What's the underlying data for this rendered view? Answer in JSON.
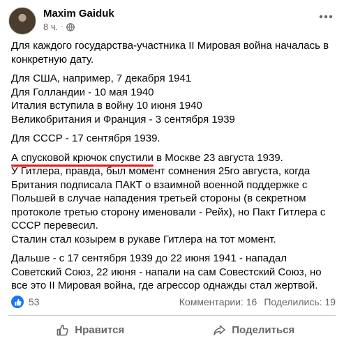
{
  "post": {
    "author": "Maxim Gaiduk",
    "time": "8 ч.",
    "separator": "·",
    "paragraph1": "Для каждого государства-участника II Мировая война началась в конкретную дату.",
    "lines2": [
      "Для США, например, 7 декабря 1941",
      "Для Голландии - 10 мая 1940",
      "Италия вступила в войну 10 июня 1940",
      "Великобритания и Франция - 3 сентября 1939"
    ],
    "paragraph3": "Для СССР - 17 сентября 1939.",
    "para4_highlight": "А спусковой крючок спустили",
    "para4_rest": " в Москве 23 августа 1939.",
    "para4_body": "У Гитлера, правда, был момент сомнения 25го августа, когда Британия подписала ПАКТ о взаимной военной поддержке с Польшей в случае нападения третьей стороны (в секретном протоколе третью сторону именовали - Рейх), но Пакт Гитлера с СССР перевесил.",
    "para4_last": "Сталин стал козырем в рукаве Гитлера на тот момент.",
    "paragraph5": "Дальше - с 17 сентября 1939 до 22 июня 1941 - нападал Советский Союз, 22 июня - напали на сам Совестский Союз, но все это II Мировая война, где агрессор однажды стал жертвой."
  },
  "stats": {
    "likes": "53",
    "comments": "Комментарии: 16",
    "shares": "Поделились: 19"
  },
  "actions": {
    "like": "Нравится",
    "share": "Поделиться"
  },
  "colors": {
    "facebook_blue": "#1877f2",
    "annotation_red": "#e11a1a",
    "secondary_text": "#65676b"
  },
  "icons": {
    "privacy": "globe-icon",
    "more": "more-dots-icon",
    "like_reaction": "thumbs-up-icon",
    "like_action": "thumbs-up-outline-icon",
    "share_action": "share-arrow-icon"
  }
}
